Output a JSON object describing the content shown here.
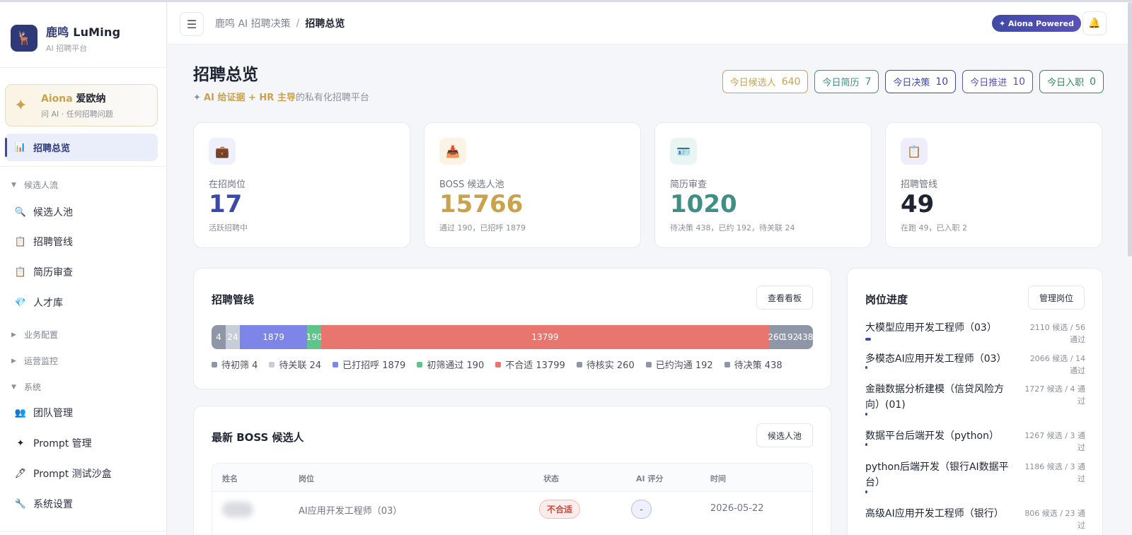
{
  "brand": {
    "name_cn": "鹿鸣",
    "name_en": "LuMing",
    "subtitle": "AI 招聘平台",
    "logo_glyph": "🦌"
  },
  "aiona": {
    "name_en": "Aiona",
    "name_cn": "爱欧纳",
    "subtitle": "问 AI · 任何招聘问题"
  },
  "nav": {
    "active": "招聘总览",
    "sections": [
      "候选人流",
      "业务配置",
      "运营监控",
      "系统"
    ],
    "items": {
      "candidate_pool": "候选人池",
      "pipeline": "招聘管线",
      "resume_review": "简历审查",
      "talent_pool": "人才库",
      "team": "团队管理",
      "prompt": "Prompt 管理",
      "sandbox": "Prompt 测试沙盒",
      "settings": "系统设置"
    }
  },
  "topbar": {
    "crumb_root": "鹿鸣 AI 招聘决策",
    "crumb_sep": "/",
    "crumb_current": "招聘总览",
    "powered": "✦ Aiona Powered"
  },
  "page": {
    "title": "招聘总览",
    "subtitle_prefix": "✦ ",
    "subtitle_highlight": "AI 给证据 + HR 主导",
    "subtitle_rest": "的私有化招聘平台"
  },
  "today_badges": [
    {
      "label": "今日候选人",
      "value": "640",
      "color": "#c9a24b"
    },
    {
      "label": "今日简历",
      "value": "7",
      "color": "#3f8f84"
    },
    {
      "label": "今日决策",
      "value": "10",
      "color": "#3b4aa8"
    },
    {
      "label": "今日推进",
      "value": "10",
      "color": "#5a52b8"
    },
    {
      "label": "今日入职",
      "value": "0",
      "color": "#2f8a5a"
    }
  ],
  "stats": [
    {
      "label": "在招岗位",
      "value": "17",
      "sub": "活跃招聘中",
      "icon": "briefcase-icon",
      "glyph": "💼",
      "color": "#3b4aa8",
      "bg": "#eef0fb"
    },
    {
      "label": "BOSS 候选人池",
      "value": "15766",
      "sub": "通过 190，已招呼 1879",
      "icon": "inbox-icon",
      "glyph": "📥",
      "color": "#c9a24b",
      "bg": "#fbf4e4"
    },
    {
      "label": "简历审查",
      "value": "1020",
      "sub": "待决策 438，已约 192，待关联 24",
      "icon": "id-card-icon",
      "glyph": "🪪",
      "color": "#3f8f84",
      "bg": "#e9f5f2"
    },
    {
      "label": "招聘管线",
      "value": "49",
      "sub": "在跑 49，已入职 2",
      "icon": "clipboard-icon",
      "glyph": "📋",
      "color": "#1f2433",
      "bg": "#eeedfb"
    }
  ],
  "pipeline": {
    "title": "招聘管线",
    "button": "查看看板",
    "segments": [
      {
        "name": "待初筛",
        "value": 4,
        "color": "#8e96a8"
      },
      {
        "name": "待关联",
        "value": 24,
        "color": "#c7ceda"
      },
      {
        "name": "已打招呼",
        "value": 1879,
        "color": "#7d86e8"
      },
      {
        "name": "初筛通过",
        "value": 190,
        "color": "#5ec48a"
      },
      {
        "name": "不合适",
        "value": 13799,
        "color": "#e8766f"
      },
      {
        "name": "待核实",
        "value": 260,
        "color": "#8e96a8"
      },
      {
        "name": "已约沟通",
        "value": 192,
        "color": "#8e96a8"
      },
      {
        "name": "待决策",
        "value": 438,
        "color": "#8e96a8"
      }
    ]
  },
  "candidates": {
    "title": "最新 BOSS 候选人",
    "button": "候选人池",
    "columns": [
      "姓名",
      "岗位",
      "状态",
      "AI 评分",
      "时间"
    ],
    "rows": [
      {
        "position": "AI应用开发工程师（03）",
        "status": "不合适",
        "score": "-",
        "date": "2026-05-22"
      }
    ]
  },
  "jobs": {
    "title": "岗位进度",
    "button": "管理岗位",
    "items": [
      {
        "title": "大模型应用开发工程师（03）",
        "stat": "2110 候选 / 56 通过",
        "progress": 0.027
      },
      {
        "title": "多模态AI应用开发工程师（03）",
        "stat": "2066 候选 / 14 通过",
        "progress": 0.007
      },
      {
        "title": "金融数据分析建模（信贷风险方向）(01)",
        "stat": "1727 候选 / 4 通过",
        "progress": 0.002
      },
      {
        "title": "数据平台后端开发（python）",
        "stat": "1267 候选 / 3 通过",
        "progress": 0.002
      },
      {
        "title": "python后端开发（银行AI数据平台）",
        "stat": "1186 候选 / 3 通过",
        "progress": 0.002
      },
      {
        "title": "高级AI应用开发工程师（银行）",
        "stat": "806 候选 / 23 通过",
        "progress": 0.028
      }
    ]
  }
}
